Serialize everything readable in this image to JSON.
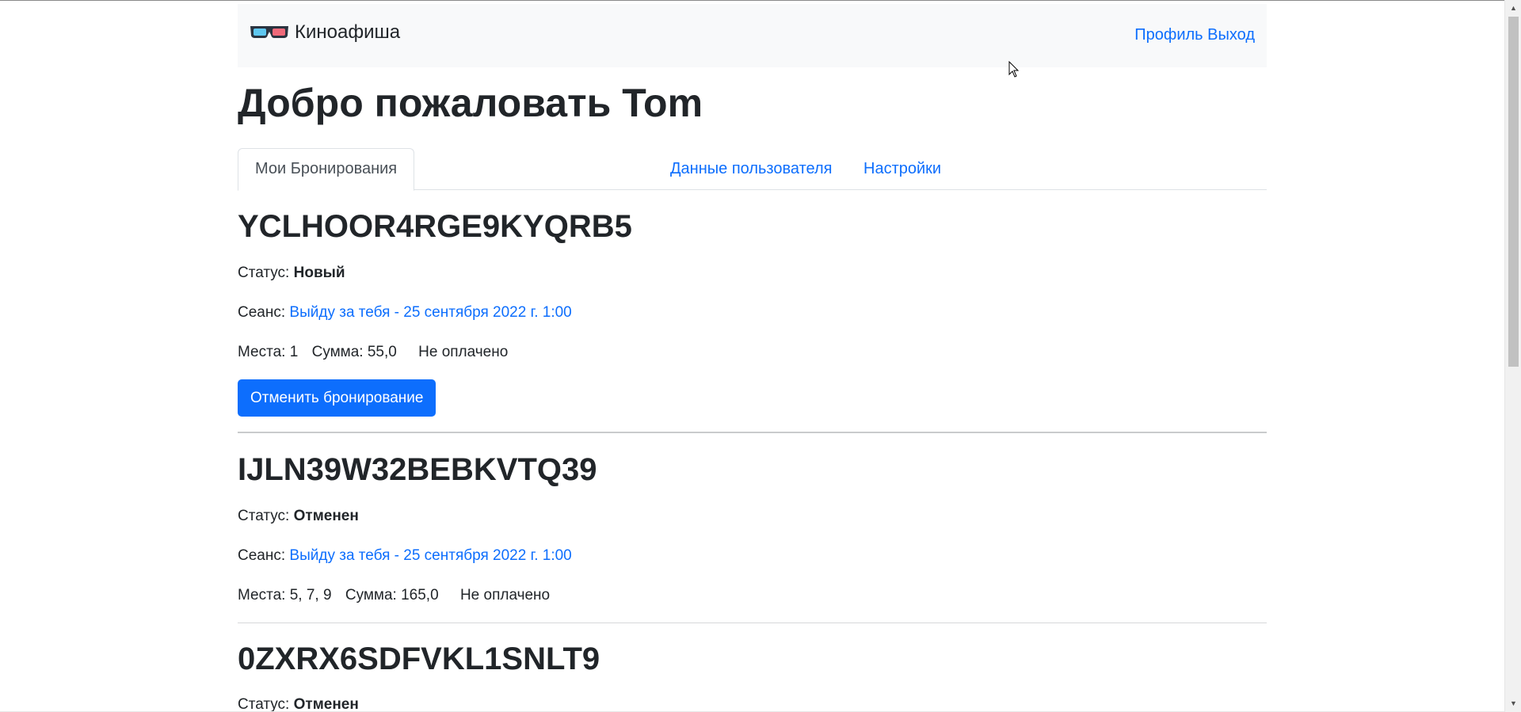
{
  "header": {
    "brand": "Киноафиша",
    "nav_profile": "Профиль",
    "nav_logout": "Выход"
  },
  "title": "Добро пожаловать Tom",
  "tabs": [
    {
      "label": "Мои Бронирования",
      "active": true
    },
    {
      "label": "Данные пользователя",
      "active": false
    },
    {
      "label": "Настройки",
      "active": false
    }
  ],
  "labels": {
    "status": "Статус:",
    "session": "Сеанс:",
    "seats": "Места:",
    "sum": "Сумма:"
  },
  "bookings": [
    {
      "code": "YCLHOOR4RGE9KYQRB5",
      "status": "Новый",
      "session": "Выйду за тебя - 25 сентября 2022 г. 1:00",
      "seats": "1",
      "sum": "55,0",
      "payment": "Не оплачено",
      "cancel_label": "Отменить бронирование"
    },
    {
      "code": "IJLN39W32BEBKVTQ39",
      "status": "Отменен",
      "session": "Выйду за тебя - 25 сентября 2022 г. 1:00",
      "seats": "5, 7, 9",
      "sum": "165,0",
      "payment": "Не оплачено"
    },
    {
      "code": "0ZXRX6SDFVKL1SNLT9",
      "status": "Отменен"
    }
  ],
  "colors": {
    "accent": "#0d6efd",
    "navbar_bg": "#f8f9fa",
    "text": "#212529"
  }
}
